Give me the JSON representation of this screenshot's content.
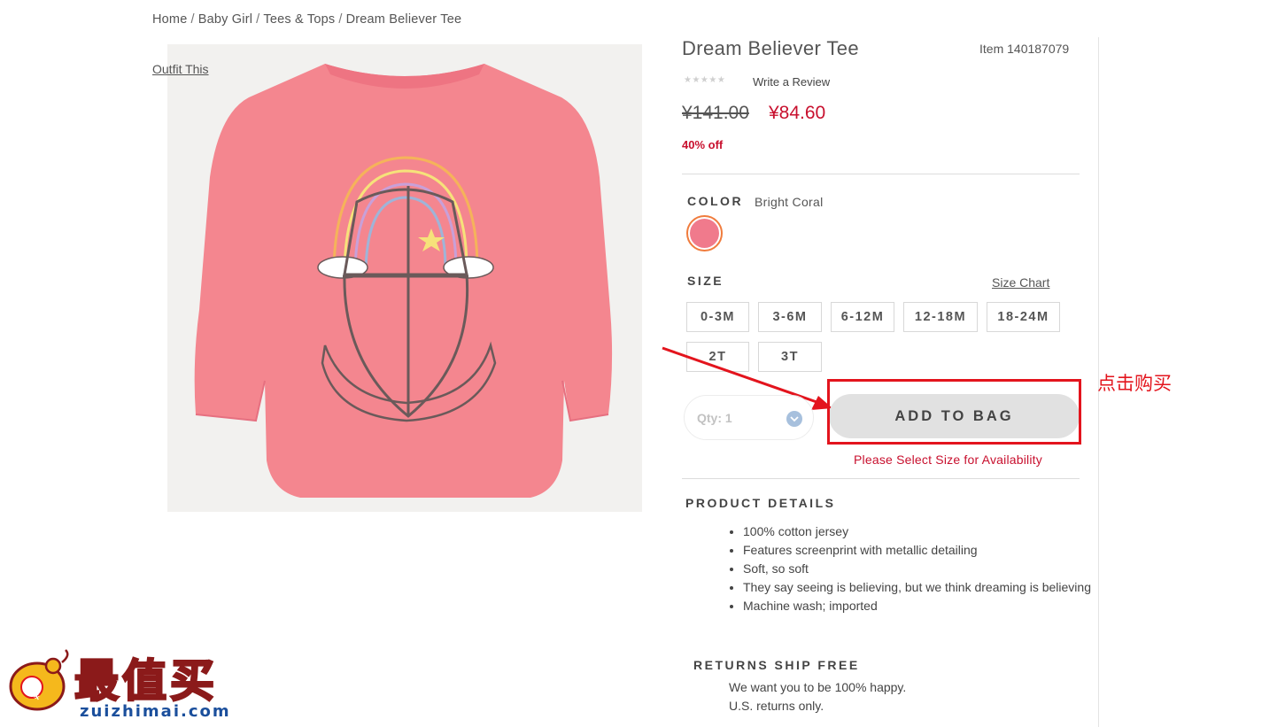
{
  "breadcrumb": [
    "Home",
    "Baby Girl",
    "Tees & Tops",
    "Dream Believer Tee"
  ],
  "breadcrumb_sep": "/",
  "outfit_link": "Outfit This",
  "product": {
    "title": "Dream Believer Tee",
    "item_number": "Item 140187079",
    "rating_stars": "★★★★★",
    "review_link": "Write a Review",
    "original_price": "¥141.00",
    "sale_price": "¥84.60",
    "discount": "40% off"
  },
  "color": {
    "label": "COLOR",
    "selected": "Bright Coral",
    "swatch_color": "#f07a8c"
  },
  "size": {
    "label": "SIZE",
    "chart_link": "Size Chart",
    "options": [
      "0-3M",
      "3-6M",
      "6-12M",
      "12-18M",
      "18-24M",
      "2T",
      "3T"
    ]
  },
  "qty": {
    "label": "Qty: 1"
  },
  "add_to_bag": "ADD TO BAG",
  "availability_warning": "Please Select Size for Availability",
  "annotation": "点击购买",
  "product_details": {
    "heading": "PRODUCT DETAILS",
    "bullets": [
      "100% cotton jersey",
      "Features screenprint with metallic detailing",
      "Soft, so soft",
      "They say seeing is believing, but we think dreaming is believing",
      "Machine wash; imported"
    ]
  },
  "returns": {
    "heading": "RETURNS SHIP FREE",
    "line1": "We want you to be 100% happy.",
    "line2": "U.S. returns only."
  },
  "watermark": {
    "name": "最值买",
    "domain": "zuizhimai.com"
  },
  "colors": {
    "sale_red": "#c8102e",
    "annotation_red": "#e3141d",
    "shirt_pink": "#f4868f"
  }
}
